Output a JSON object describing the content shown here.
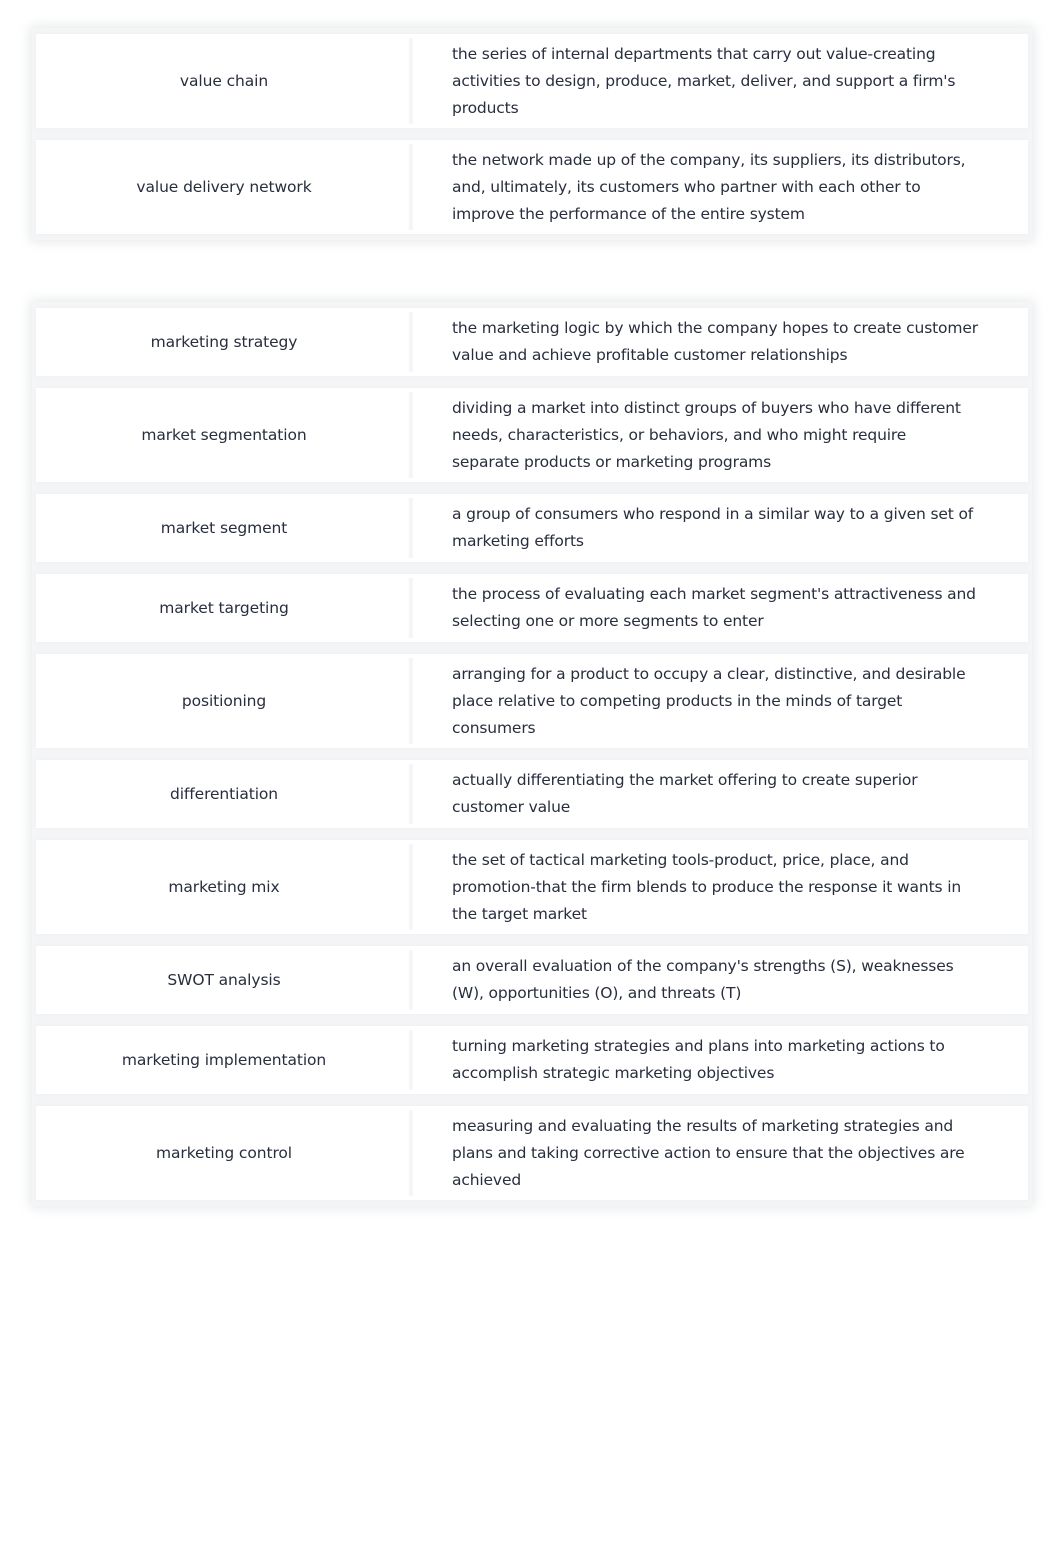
{
  "sets": [
    {
      "rows": [
        {
          "term": "value chain",
          "definition": "the series of internal departments that carry out value-creating activities to design, produce, market, deliver, and support a firm's products"
        },
        {
          "term": "value delivery network",
          "definition": "the network made up of the company, its suppliers, its distributors, and, ultimately, its customers who partner with each other to improve the performance of the entire system"
        }
      ]
    },
    {
      "rows": [
        {
          "term": "marketing strategy",
          "definition": "the marketing logic by which the company hopes to create customer value and achieve profitable customer relationships"
        },
        {
          "term": "market segmentation",
          "definition": "dividing a market into distinct groups of buyers who have different needs, characteristics, or behaviors, and who might require separate products or marketing programs"
        },
        {
          "term": "market segment",
          "definition": "a group of consumers who respond in a similar way to a given set of marketing efforts"
        },
        {
          "term": "market targeting",
          "definition": "the process of evaluating each market segment's attractiveness and selecting one or more segments to enter"
        },
        {
          "term": "positioning",
          "definition": "arranging for a product to occupy a clear, distinctive, and desirable place relative to competing products in the minds of target consumers"
        },
        {
          "term": "differentiation",
          "definition": "actually differentiating the market offering to create superior customer value"
        },
        {
          "term": "marketing mix",
          "definition": "the set of tactical marketing tools-product, price, place, and promotion-that the firm blends to produce the response it wants in the target market"
        },
        {
          "term": "SWOT analysis",
          "definition": "an overall evaluation of the company's strengths (S), weaknesses (W), opportunities (O), and threats (T)"
        },
        {
          "term": "marketing implementation",
          "definition": "turning marketing strategies and plans into marketing actions to accomplish strategic marketing objectives"
        },
        {
          "term": "marketing control",
          "definition": "measuring and evaluating the results of marketing strategies and plans and taking corrective action to ensure that the objectives are achieved"
        }
      ]
    }
  ]
}
